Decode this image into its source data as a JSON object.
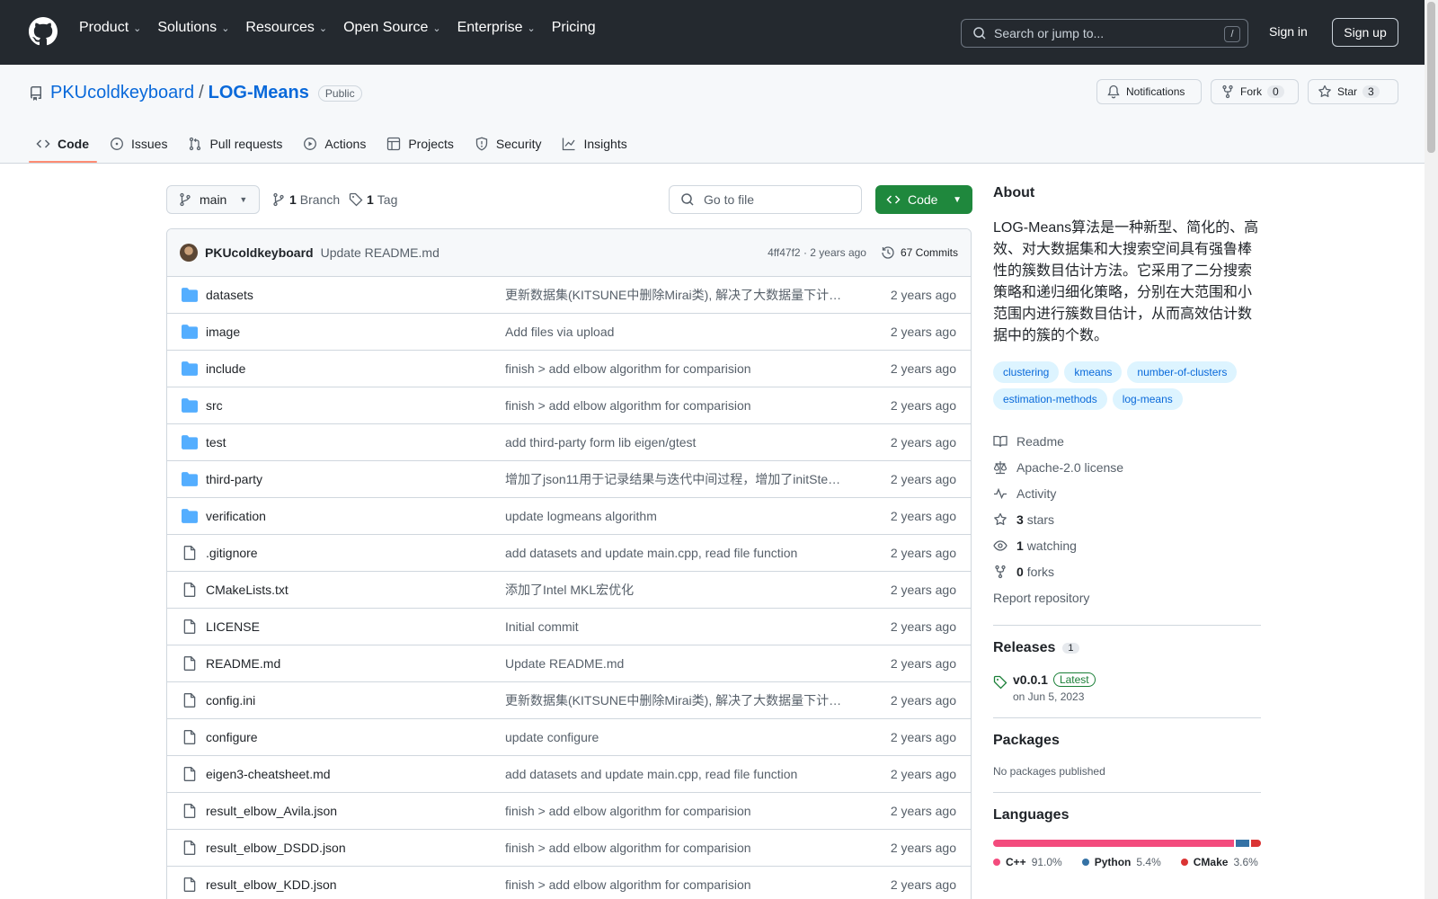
{
  "header": {
    "nav": [
      {
        "label": "Product",
        "has_menu": true
      },
      {
        "label": "Solutions",
        "has_menu": true
      },
      {
        "label": "Resources",
        "has_menu": true
      },
      {
        "label": "Open Source",
        "has_menu": true
      },
      {
        "label": "Enterprise",
        "has_menu": true
      },
      {
        "label": "Pricing",
        "has_menu": false
      }
    ],
    "search_placeholder": "Search or jump to...",
    "search_shortcut": "/",
    "sign_in": "Sign in",
    "sign_up": "Sign up"
  },
  "repo": {
    "owner": "PKUcoldkeyboard",
    "separator": "/",
    "name": "LOG-Means",
    "visibility": "Public",
    "notifications_label": "Notifications",
    "fork_label": "Fork",
    "fork_count": "0",
    "star_label": "Star",
    "star_count": "3",
    "tabs": [
      {
        "label": "Code",
        "icon": "code-icon",
        "active": true
      },
      {
        "label": "Issues",
        "icon": "issue-icon",
        "active": false
      },
      {
        "label": "Pull requests",
        "icon": "pull-request-icon",
        "active": false
      },
      {
        "label": "Actions",
        "icon": "play-icon",
        "active": false
      },
      {
        "label": "Projects",
        "icon": "table-icon",
        "active": false
      },
      {
        "label": "Security",
        "icon": "shield-icon",
        "active": false
      },
      {
        "label": "Insights",
        "icon": "graph-icon",
        "active": false
      }
    ]
  },
  "toolbar": {
    "branch": "main",
    "branch_count": "1",
    "branch_label": "Branch",
    "tag_count": "1",
    "tag_label": "Tag",
    "go_to_file": "Go to file",
    "code_button": "Code"
  },
  "latest_commit": {
    "author": "PKUcoldkeyboard",
    "message": "Update README.md",
    "meta": "4ff47f2 · 2 years ago",
    "commits": "67 Commits"
  },
  "files": [
    {
      "name": "datasets",
      "type": "dir",
      "message": "更新数据集(KITSUNE中删除Mirai类), 解决了大数据量下计…",
      "date": "2 years ago"
    },
    {
      "name": "image",
      "type": "dir",
      "message": "Add files via upload",
      "date": "2 years ago"
    },
    {
      "name": "include",
      "type": "dir",
      "message": "finish > add elbow algorithm for comparision",
      "date": "2 years ago"
    },
    {
      "name": "src",
      "type": "dir",
      "message": "finish > add elbow algorithm for comparision",
      "date": "2 years ago"
    },
    {
      "name": "test",
      "type": "dir",
      "message": "add third-party form lib eigen/gtest",
      "date": "2 years ago"
    },
    {
      "name": "third-party",
      "type": "dir",
      "message": "增加了json11用于记录结果与迭代中间过程，增加了initStep…",
      "date": "2 years ago"
    },
    {
      "name": "verification",
      "type": "dir",
      "message": "update logmeans algorithm",
      "date": "2 years ago"
    },
    {
      "name": ".gitignore",
      "type": "file",
      "message": "add datasets and update main.cpp, read file function",
      "date": "2 years ago"
    },
    {
      "name": "CMakeLists.txt",
      "type": "file",
      "message": "添加了Intel MKL宏优化",
      "date": "2 years ago"
    },
    {
      "name": "LICENSE",
      "type": "file",
      "message": "Initial commit",
      "date": "2 years ago"
    },
    {
      "name": "README.md",
      "type": "file",
      "message": "Update README.md",
      "date": "2 years ago"
    },
    {
      "name": "config.ini",
      "type": "file",
      "message": "更新数据集(KITSUNE中删除Mirai类), 解决了大数据量下计…",
      "date": "2 years ago"
    },
    {
      "name": "configure",
      "type": "file",
      "message": "update configure",
      "date": "2 years ago"
    },
    {
      "name": "eigen3-cheatsheet.md",
      "type": "file",
      "message": "add datasets and update main.cpp, read file function",
      "date": "2 years ago"
    },
    {
      "name": "result_elbow_Avila.json",
      "type": "file",
      "message": "finish > add elbow algorithm for comparision",
      "date": "2 years ago"
    },
    {
      "name": "result_elbow_DSDD.json",
      "type": "file",
      "message": "finish > add elbow algorithm for comparision",
      "date": "2 years ago"
    },
    {
      "name": "result_elbow_KDD.json",
      "type": "file",
      "message": "finish > add elbow algorithm for comparision",
      "date": "2 years ago"
    }
  ],
  "about": {
    "heading": "About",
    "description": "LOG-Means算法是一种新型、简化的、高效、对大数据集和大搜索空间具有强鲁棒性的簇数目估计方法。它采用了二分搜索策略和递归细化策略，分别在大范围和小范围内进行簇数目估计，从而高效估计数据中的簇的个数。",
    "topics": [
      "clustering",
      "kmeans",
      "number-of-clusters",
      "estimation-methods",
      "log-means"
    ],
    "links": [
      {
        "icon": "book-icon",
        "count": "",
        "label": "Readme"
      },
      {
        "icon": "law-icon",
        "count": "",
        "label": "Apache-2.0 license"
      },
      {
        "icon": "pulse-icon",
        "count": "",
        "label": "Activity"
      },
      {
        "icon": "star-icon",
        "count": "3",
        "label": "stars"
      },
      {
        "icon": "eye-icon",
        "count": "1",
        "label": "watching"
      },
      {
        "icon": "fork-icon",
        "count": "0",
        "label": "forks"
      }
    ],
    "report": "Report repository"
  },
  "releases": {
    "heading": "Releases",
    "count": "1",
    "tag": "v0.0.1",
    "latest_label": "Latest",
    "date": "on Jun 5, 2023"
  },
  "packages": {
    "heading": "Packages",
    "text": "No packages published"
  },
  "languages": {
    "heading": "Languages",
    "items": [
      {
        "name": "C++",
        "percent": 91.0,
        "percent_label": "91.0%",
        "color": "#f34b7d"
      },
      {
        "name": "Python",
        "percent": 5.4,
        "percent_label": "5.4%",
        "color": "#3572A5"
      },
      {
        "name": "CMake",
        "percent": 3.6,
        "percent_label": "3.6%",
        "color": "#DA3434"
      }
    ]
  }
}
